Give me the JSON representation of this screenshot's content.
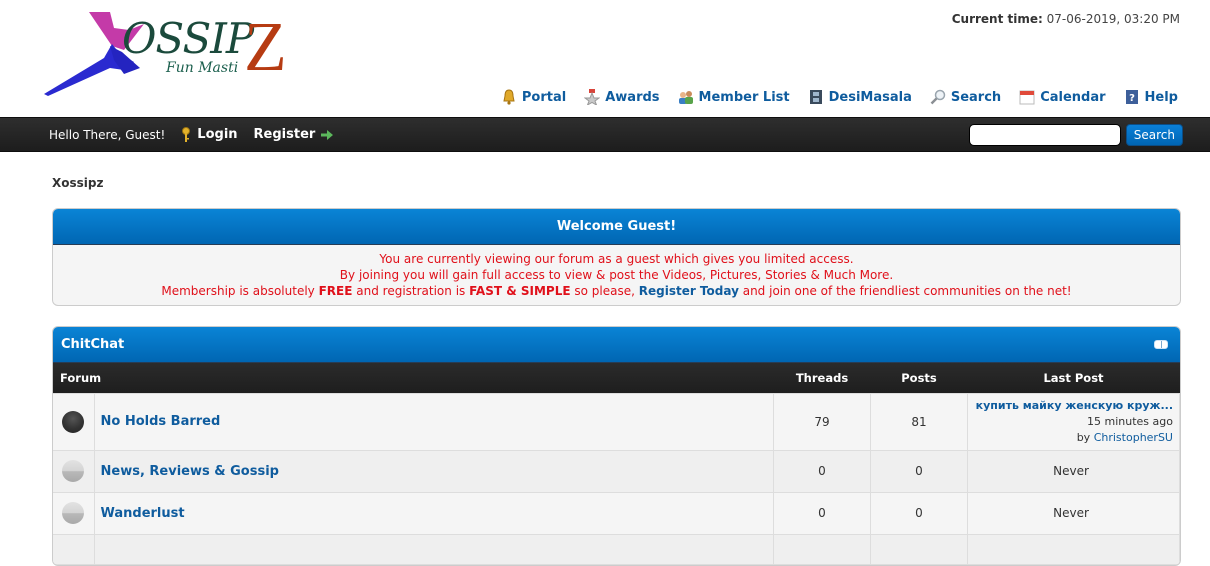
{
  "header": {
    "logo": {
      "word": "OSSIP",
      "z": "Z",
      "tagline": "Fun Masti"
    },
    "current_time_label": "Current time:",
    "current_time_value": "07-06-2019, 03:20 PM",
    "links": [
      {
        "label": "Portal",
        "icon": "bell-icon"
      },
      {
        "label": "Awards",
        "icon": "award-star-icon"
      },
      {
        "label": "Member List",
        "icon": "members-icon"
      },
      {
        "label": "DesiMasala",
        "icon": "film-icon"
      },
      {
        "label": "Search",
        "icon": "magnifier-icon"
      },
      {
        "label": "Calendar",
        "icon": "calendar-icon"
      },
      {
        "label": "Help",
        "icon": "help-book-icon"
      }
    ]
  },
  "panel": {
    "greeting": "Hello There, Guest!",
    "login_label": "Login",
    "register_label": "Register",
    "search_placeholder": "",
    "search_button": "Search"
  },
  "breadcrumb": "Xossipz",
  "welcome": {
    "title": "Welcome Guest!",
    "line1": "You are currently viewing our forum as a guest which gives you limited access.",
    "line2": "By joining you will gain full access to view & post the Videos, Pictures, Stories & Much More.",
    "line3_a": "Membership is absolutely ",
    "line3_free": "FREE",
    "line3_b": " and registration is ",
    "line3_fast": "FAST & SIMPLE",
    "line3_c": " so please, ",
    "line3_link": "Register Today",
    "line3_d": " and join one of the friendliest communities on the net!"
  },
  "category": {
    "title": "ChitChat",
    "columns": {
      "forum": "Forum",
      "threads": "Threads",
      "posts": "Posts",
      "last_post": "Last Post"
    },
    "forums": [
      {
        "name": "No Holds Barred",
        "status": "new",
        "threads": "79",
        "posts": "81",
        "last_post": {
          "title": "купить майку женскую круж...",
          "time": "15 minutes ago",
          "by": "by ",
          "author": "ChristopherSU"
        }
      },
      {
        "name": "News, Reviews & Gossip",
        "status": "old",
        "threads": "0",
        "posts": "0",
        "last_post_text": "Never"
      },
      {
        "name": "Wanderlust",
        "status": "old",
        "threads": "0",
        "posts": "0",
        "last_post_text": "Never"
      }
    ]
  }
}
